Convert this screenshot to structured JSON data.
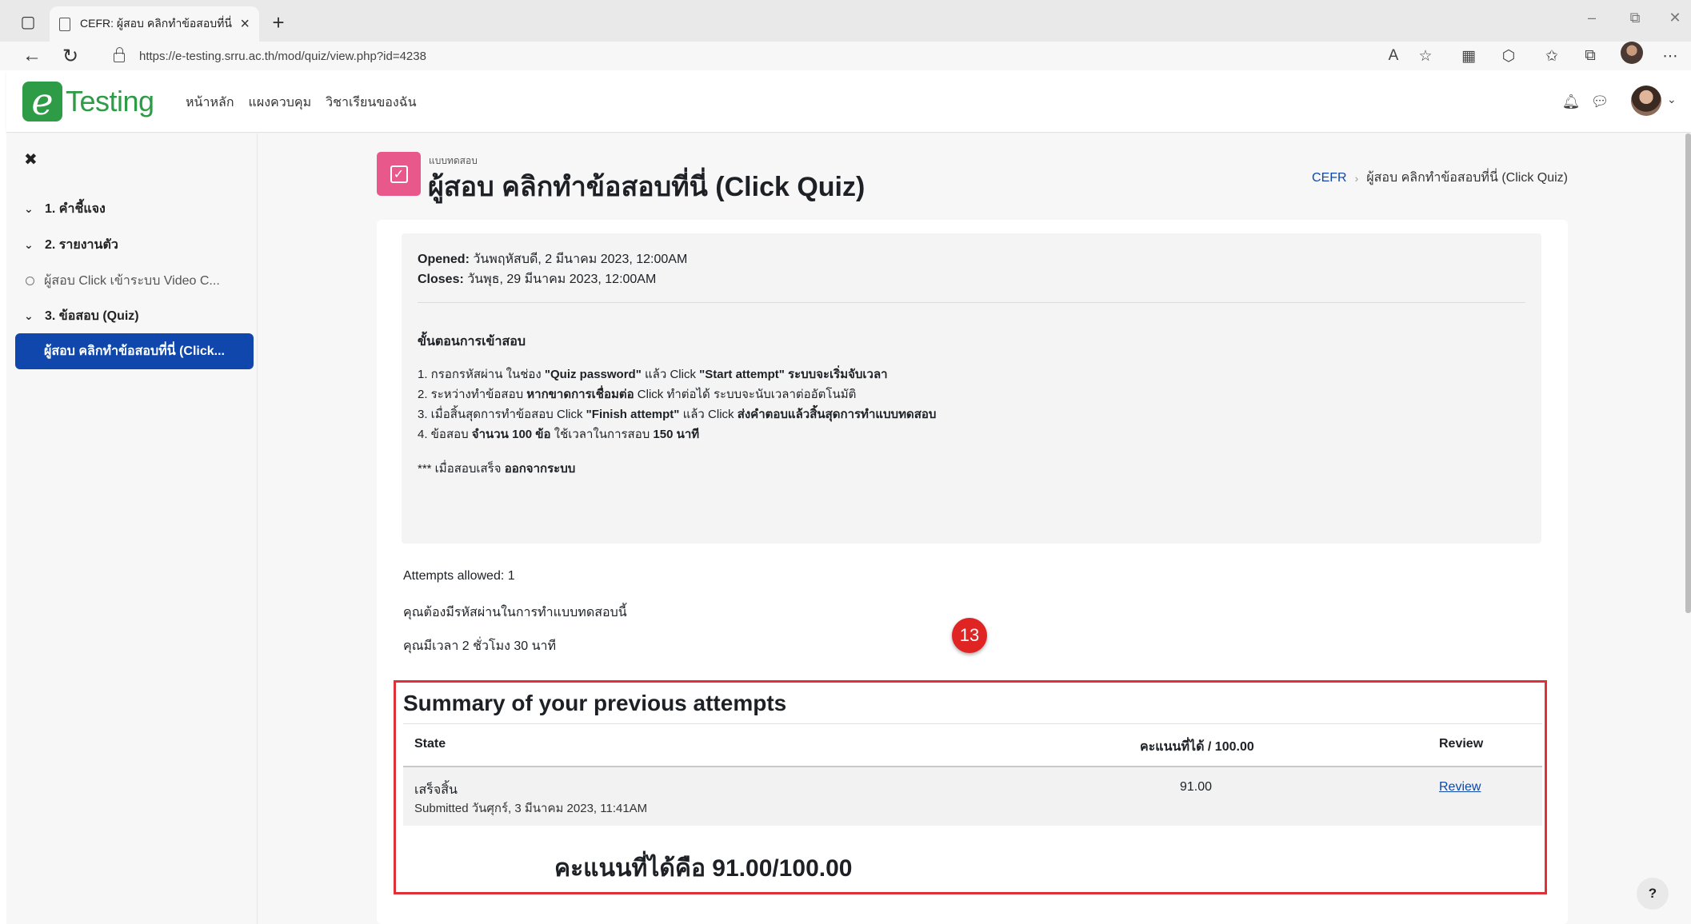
{
  "browser": {
    "tab_title": "CEFR: ผู้สอบ คลิกทำข้อสอบที่นี่ (Click",
    "url": "https://e-testing.srru.ac.th/mod/quiz/view.php?id=4238"
  },
  "site": {
    "logo_text": "Testing",
    "nav": [
      "หน้าหลัก",
      "แผงควบคุม",
      "วิชาเรียนของฉัน"
    ]
  },
  "sidebar": {
    "items": [
      {
        "label": "1. คำชี้แจง"
      },
      {
        "label": "2. รายงานตัว"
      },
      {
        "label": "ผู้สอบ Click เข้าระบบ Video C..."
      },
      {
        "label": "3. ข้อสอบ (Quiz)"
      },
      {
        "label": "ผู้สอบ คลิกทำข้อสอบที่นี่ (Click..."
      }
    ]
  },
  "page": {
    "kicker": "แบบทดสอบ",
    "title": "ผู้สอบ คลิกทำข้อสอบที่นี่ (Click Quiz)",
    "breadcrumb": [
      "CEFR",
      "ผู้สอบ คลิกทำข้อสอบที่นี่ (Click Quiz)"
    ]
  },
  "intro": {
    "opened_label": "Opened:",
    "opened_value": "วันพฤหัสบดี, 2 มีนาคม 2023, 12:00AM",
    "closes_label": "Closes:",
    "closes_value": "วันพุธ, 29 มีนาคม 2023, 12:00AM",
    "steps_heading": "ขั้นตอนการเข้าสอบ",
    "steps": [
      {
        "a": "1. กรอกรหัสผ่าน ในช่อง ",
        "b": "\"Quiz password\"",
        "c": " แล้ว Click ",
        "d": "\"Start attempt\"",
        "e": " ระบบจะเริ่มจับเวลา"
      },
      {
        "a": "2. ระหว่างทำข้อสอบ ",
        "b": "หากขาดการเชื่อมต่อ",
        "c": " Click ทำต่อได้ ระบบจะนับเวลาต่ออัตโนมัติ",
        "d": "",
        "e": ""
      },
      {
        "a": "3. เมื่อสิ้นสุดการทำข้อสอบ Click ",
        "b": "\"Finish attempt\"",
        "c": " แล้ว Click ",
        "d": "ส่งคำตอบแล้วสิ้นสุดการทำแบบทดสอบ",
        "e": ""
      },
      {
        "a": "4. ข้อสอบ ",
        "b": "จำนวน 100 ข้อ",
        "c": " ใช้เวลาในการสอบ ",
        "d": "150 นาที",
        "e": ""
      }
    ],
    "note_prefix": "*** เมื่อสอบเสร็จ ",
    "note_bold": "ออกจากระบบ"
  },
  "meta": {
    "attempts_allowed": "Attempts allowed: 1",
    "password_note": "คุณต้องมีรหัสผ่านในการทำแบบทดสอบนี้",
    "time_limit": "คุณมีเวลา 2 ชั่วโมง 30 นาที"
  },
  "annotation_badge": "13",
  "summary": {
    "title": "Summary of your previous attempts",
    "headers": {
      "state": "State",
      "score": "คะแนนที่ได้ / 100.00",
      "review": "Review"
    },
    "rows": [
      {
        "state": "เสร็จสิ้น",
        "submitted": "Submitted วันศุกร์, 3 มีนาคม 2023, 11:41AM",
        "score": "91.00",
        "review": "Review"
      }
    ],
    "final_label": "คะแนนที่ได้คือ  91.00/100.00"
  },
  "help_label": "?",
  "colors": {
    "accent": "#0f47ad",
    "brand_green": "#2e9b47",
    "quiz_icon": "#e8588a",
    "highlight_red": "#e0303a"
  }
}
